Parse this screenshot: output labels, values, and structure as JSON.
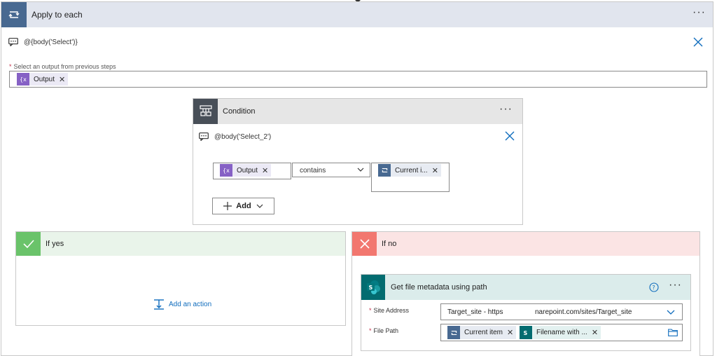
{
  "apply_to_each": {
    "title": "Apply to each",
    "expression": "@{body('Select')}",
    "output_label": "Select an output from previous steps",
    "output_token": "Output"
  },
  "condition": {
    "title": "Condition",
    "expression": "@body('Select_2')",
    "left_token": "Output",
    "operator": "contains",
    "right_token": "Current i...",
    "add_label": "Add"
  },
  "if_yes": {
    "title": "If yes",
    "add_action_label": "Add an action"
  },
  "if_no": {
    "title": "If no"
  },
  "get_file_metadata": {
    "title": "Get file metadata using path",
    "site_address_label": "Site Address",
    "site_address_value": "Target_site - https",
    "site_address_value_2": "narepoint.com/sites/Target_site",
    "file_path_label": "File Path",
    "file_path_token_1": "Current item",
    "file_path_token_2": "Filename with ..."
  },
  "colors": {
    "accent": "#0f6cbd",
    "apply_icon_bg": "#486991",
    "condition_icon_bg": "#484f58",
    "yes_bg": "#6ac36a",
    "no_bg": "#f2776f",
    "sharepoint": "#036c70"
  }
}
